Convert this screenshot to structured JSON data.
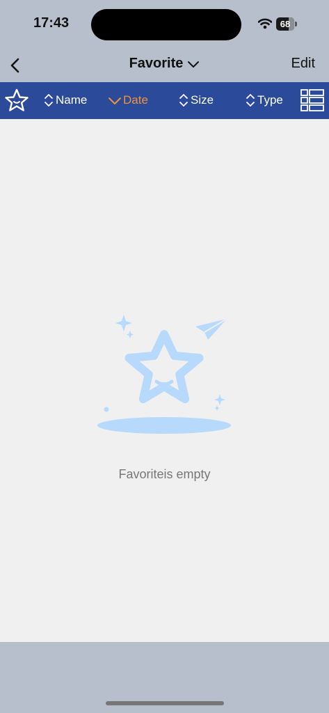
{
  "status_bar": {
    "time": "17:43",
    "battery_level": "68",
    "wifi_icon": "wifi-icon"
  },
  "nav": {
    "back_icon": "chevron-left-icon",
    "title": "Favorite",
    "title_icon": "chevron-down-icon",
    "edit_label": "Edit"
  },
  "toolbar": {
    "favorite_icon": "star-icon",
    "sort_items": [
      {
        "label": "Name",
        "icon": "sort-updown-icon",
        "active": false
      },
      {
        "label": "Date",
        "icon": "chevron-down-icon",
        "active": true
      },
      {
        "label": "Size",
        "icon": "sort-updown-icon",
        "active": false
      },
      {
        "label": "Type",
        "icon": "sort-updown-icon",
        "active": false
      }
    ],
    "layout_icon": "list-grid-icon"
  },
  "empty_state": {
    "illustration_icon": "smiling-star-icon",
    "message": "Favoriteis empty"
  },
  "colors": {
    "bar_bg": "#b6bfcb",
    "toolbar_bg": "#2b4b9a",
    "active_sort": "#f0923a",
    "illustration": "#b7d9fb"
  }
}
